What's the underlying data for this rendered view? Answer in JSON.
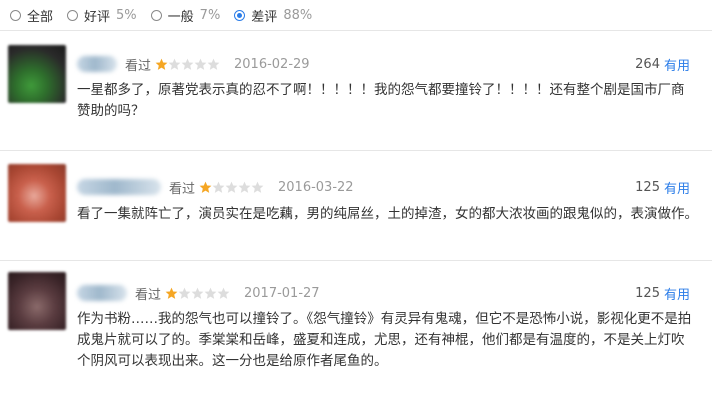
{
  "filters": [
    {
      "label": "全部",
      "pct": "",
      "checked": false
    },
    {
      "label": "好评",
      "pct": "5%",
      "checked": false
    },
    {
      "label": "一般",
      "pct": "7%",
      "checked": false
    },
    {
      "label": "差评",
      "pct": "88%",
      "checked": true
    }
  ],
  "colors": {
    "accent": "#2a7ce8",
    "star_filled": "#f5a623",
    "star_empty": "#dddddd"
  },
  "reviews": [
    {
      "status": "看过",
      "rating": 1,
      "date": "2016-02-29",
      "useful_count": "264",
      "useful_label": "有用",
      "content": "一星都多了，原著党表示真的忍不了啊！！！！！我的怨气都要撞铃了！！！！还有整个剧是国市厂商赞助的吗？"
    },
    {
      "status": "看过",
      "rating": 1,
      "date": "2016-03-22",
      "useful_count": "125",
      "useful_label": "有用",
      "content": "看了一集就阵亡了，演员实在是吃藕，男的纯屌丝，土的掉渣，女的都大浓妆画的跟鬼似的，表演做作。"
    },
    {
      "status": "看过",
      "rating": 1,
      "date": "2017-01-27",
      "useful_count": "125",
      "useful_label": "有用",
      "content": "作为书粉……我的怨气也可以撞铃了。《怨气撞铃》有灵异有鬼魂，但它不是恐怖小说，影视化更不是拍成鬼片就可以了的。季棠棠和岳峰，盛夏和连成，尤思，还有神棍，他们都是有温度的，不是关上灯吹个阴风可以表现出来。这一分也是给原作者尾鱼的。"
    }
  ]
}
